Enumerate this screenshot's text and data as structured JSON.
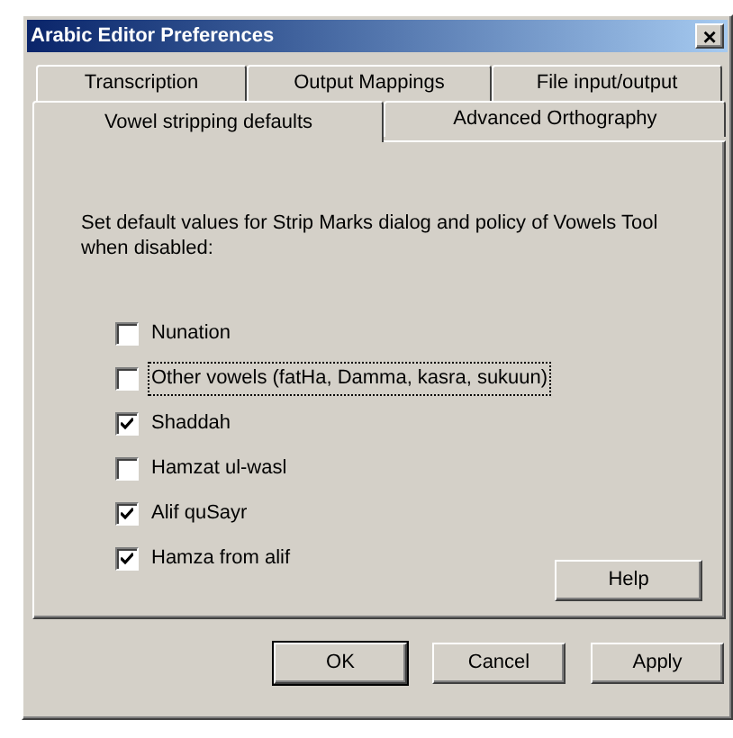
{
  "window": {
    "title": "Arabic Editor Preferences",
    "close": "×"
  },
  "tab_rows": [
    {
      "tabs": [
        {
          "label": "Transcription",
          "selected": false
        },
        {
          "label": "Output Mappings",
          "selected": false
        },
        {
          "label": "File input/output",
          "selected": false
        }
      ]
    },
    {
      "tabs": [
        {
          "label": "Vowel stripping defaults",
          "selected": true
        },
        {
          "label": "Advanced Orthography",
          "selected": false
        }
      ]
    }
  ],
  "description": "Set default values for Strip Marks dialog and policy of Vowels Tool when disabled:",
  "options": [
    {
      "label": "Nunation",
      "checked": false,
      "focused": false
    },
    {
      "label": "Other vowels (fatHa, Damma, kasra, sukuun)",
      "checked": false,
      "focused": true
    },
    {
      "label": "Shaddah",
      "checked": true,
      "focused": false
    },
    {
      "label": "Hamzat ul-wasl",
      "checked": false,
      "focused": false
    },
    {
      "label": "Alif quSayr",
      "checked": true,
      "focused": false
    },
    {
      "label": "Hamza from alif",
      "checked": true,
      "focused": false
    }
  ],
  "help_button": "Help",
  "buttons": [
    {
      "label": "OK",
      "default": true
    },
    {
      "label": "Cancel",
      "default": false
    },
    {
      "label": "Apply",
      "default": false
    }
  ]
}
